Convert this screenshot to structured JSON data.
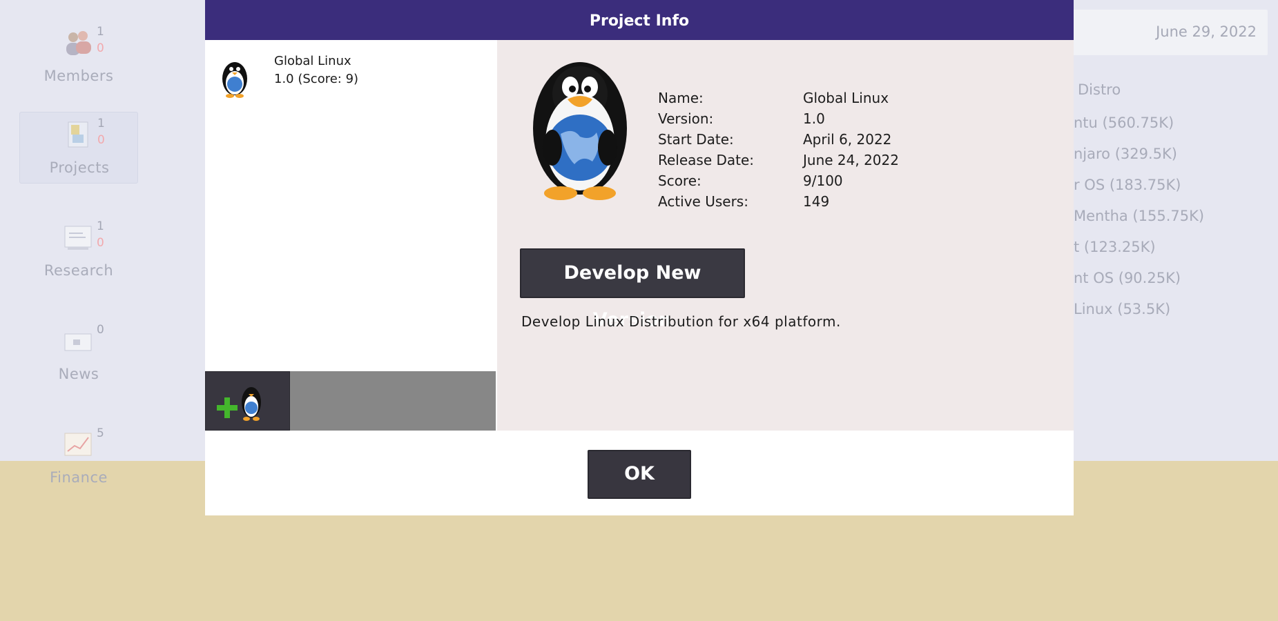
{
  "sidebar": {
    "items": [
      {
        "label": "Members",
        "count_a": "1",
        "count_b": "0"
      },
      {
        "label": "Projects",
        "count_a": "1",
        "count_b": "0"
      },
      {
        "label": "Research",
        "count_a": "1",
        "count_b": "0"
      },
      {
        "label": "News",
        "count_a": "0",
        "count_b": ""
      },
      {
        "label": "Finance",
        "count_a": "5",
        "count_b": ""
      }
    ]
  },
  "header": {
    "date": "June 29, 2022"
  },
  "distro_panel": {
    "title": "Distro",
    "items": [
      "ntu (560.75K)",
      "njaro (329.5K)",
      "r OS (183.75K)",
      "Mentha (155.75K)",
      "t (123.25K)",
      "nt OS (90.25K)",
      "Linux (53.5K)"
    ]
  },
  "dialog": {
    "title": "Project Info",
    "project_list": [
      {
        "name": "Global Linux",
        "sub": "1.0 (Score: 9)"
      }
    ],
    "info": {
      "name_label": "Name:",
      "name_value": "Global Linux",
      "version_label": "Version:",
      "version_value": "1.0",
      "start_label": "Start Date:",
      "start_value": "April 6, 2022",
      "release_label": "Release Date:",
      "release_value": "June 24, 2022",
      "score_label": "Score:",
      "score_value": "9/100",
      "users_label": "Active Users:",
      "users_value": "149"
    },
    "develop_button": "Develop New Version",
    "description": "Develop Linux Distribution for x64 platform.",
    "ok_button": "OK"
  },
  "colors": {
    "title_bar": "#3b2d7c",
    "button_dark": "#38363f",
    "info_panel_bg": "#f0e9e9",
    "floor": "#e3d5ac"
  },
  "icons": [
    "members-icon",
    "projects-icon",
    "research-icon",
    "news-icon",
    "finance-icon",
    "penguin-icon",
    "add-penguin-icon"
  ]
}
